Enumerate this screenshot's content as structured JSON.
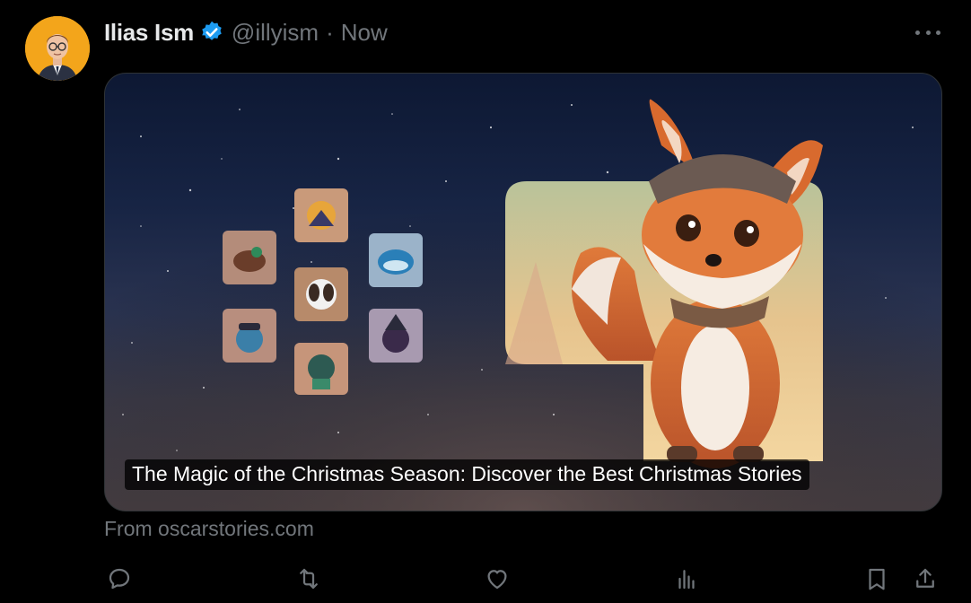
{
  "tweet": {
    "author_name": "Ilias Ism",
    "handle": "@illyism",
    "separator": "·",
    "time": "Now"
  },
  "card": {
    "title": "The Magic of the Christmas Season: Discover the Best Christmas Stories",
    "source": "From oscarstories.com"
  },
  "icons": {
    "verified": "verified-badge-icon",
    "more": "more-dots-icon",
    "reply": "reply-icon",
    "retweet": "retweet-icon",
    "like": "like-heart-icon",
    "views": "views-chart-icon",
    "bookmark": "bookmark-icon",
    "share": "share-icon"
  },
  "colors": {
    "background": "#000000",
    "text": "#e7e9ea",
    "muted": "#71767b",
    "verified": "#1d9bf0",
    "avatar_bg": "#f3a51b"
  }
}
